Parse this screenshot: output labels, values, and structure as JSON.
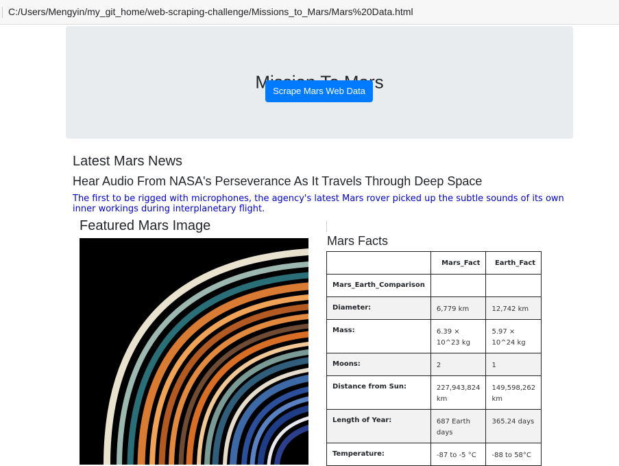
{
  "browser": {
    "url": "C:/Users/Mengyin/my_git_home/web-scraping-challenge/Missions_to_Mars/Mars%20Data.html"
  },
  "jumbotron": {
    "title": "Mission To Mars",
    "button_label": "Scrape Mars Web Data"
  },
  "news": {
    "heading": "Latest Mars News",
    "title": "Hear Audio From NASA's Perseverance As It Travels Through Deep Space",
    "teaser": "The first to be rigged with microphones, the agency's latest Mars rover picked up the subtle sounds of its own inner workings during interplanetary flight."
  },
  "featured": {
    "heading": "Featured Mars Image",
    "image_icon": "saturn-rings-photo"
  },
  "facts": {
    "heading": "Mars Facts",
    "columns": [
      "",
      "Mars_Fact",
      "Earth_Fact"
    ],
    "index_label": "Mars_Earth_Comparison",
    "rows": [
      {
        "label": "Diameter:",
        "mars": "6,779 km",
        "earth": "12,742 km"
      },
      {
        "label": "Mass:",
        "mars": "6.39 × 10^23 kg",
        "earth": "5.97 × 10^24 kg"
      },
      {
        "label": "Moons:",
        "mars": "2",
        "earth": "1"
      },
      {
        "label": "Distance from Sun:",
        "mars": "227,943,824 km",
        "earth": "149,598,262 km"
      },
      {
        "label": "Length of Year:",
        "mars": "687 Earth days",
        "earth": "365.24 days"
      },
      {
        "label": "Temperature:",
        "mars": "-87 to -5 °C",
        "earth": "-88 to 58°C"
      }
    ]
  },
  "colors": {
    "button": "#007bff",
    "jumbotron_bg": "#e9ecef",
    "teaser_text": "#0000cc"
  }
}
